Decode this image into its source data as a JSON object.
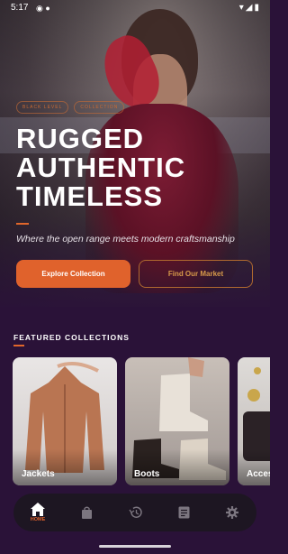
{
  "status": {
    "time": "5:17",
    "icons": "◉ ●",
    "right": "▾◢▮"
  },
  "hero": {
    "badges": [
      "BLACK LEVEL",
      "COLLECTION"
    ],
    "headline": [
      "RUGGED",
      "AUTHENTIC",
      "TIMELESS"
    ],
    "tagline": "Where the open range meets modern craftsmanship",
    "primary_button": "Explore Collection",
    "secondary_button": "Find Our Market"
  },
  "featured": {
    "title": "FEATURED COLLECTIONS",
    "cards": [
      {
        "label": "Jackets"
      },
      {
        "label": "Boots"
      },
      {
        "label": "Acces"
      }
    ]
  },
  "nav": {
    "items": [
      {
        "icon": "home-icon",
        "label": "HOME",
        "active": true
      },
      {
        "icon": "shopping-bag-icon",
        "label": "",
        "active": false
      },
      {
        "icon": "history-icon",
        "label": "",
        "active": false
      },
      {
        "icon": "receipt-icon",
        "label": "",
        "active": false
      },
      {
        "icon": "settings-icon",
        "label": "",
        "active": false
      }
    ]
  },
  "colors": {
    "accent": "#e0622c",
    "background": "#2a1238"
  }
}
